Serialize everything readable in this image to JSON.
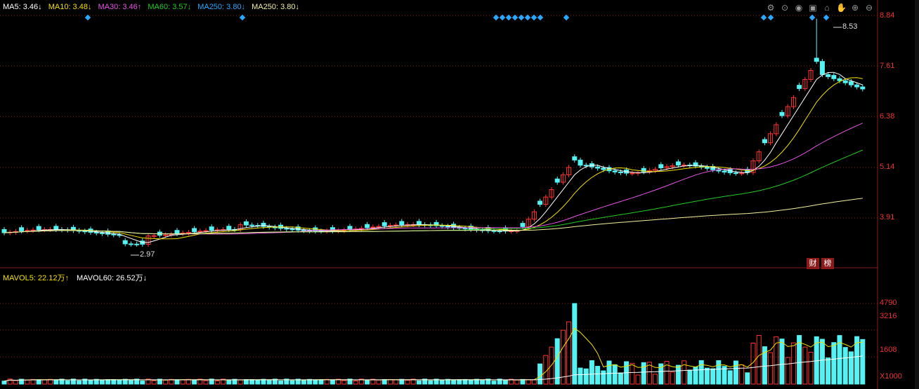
{
  "ma_legend": [
    {
      "label": "MA5: 3.46↓",
      "color": "#ffffff"
    },
    {
      "label": "MA10: 3.48↓",
      "color": "#f2e000"
    },
    {
      "label": "MA30: 3.46↑",
      "color": "#e655e6"
    },
    {
      "label": "MA60: 3.57↓",
      "color": "#22cc22"
    },
    {
      "label": "MA250: 3.80↓",
      "color": "#2aa8ff"
    },
    {
      "label": "MA250: 3.80↓",
      "color": "#f2f2a0"
    }
  ],
  "vol_legend": [
    {
      "label": "MAVOL5: 22.12万↑",
      "color": "#f2e000"
    },
    {
      "label": "MAVOL60: 26.52万↓",
      "color": "#ffffff"
    }
  ],
  "price_axis": [
    "8.84",
    "7.61",
    "6.38",
    "5.14",
    "3.91"
  ],
  "vol_axis": [
    "4790",
    "3216",
    "1608",
    "X1000"
  ],
  "high_label": "8.53",
  "low_label": "2.97",
  "badges": [
    "财",
    "榜"
  ],
  "toolbar_icons": [
    "settings-icon",
    "zoom-icon",
    "eye-icon",
    "lock-icon",
    "home-icon",
    "hand-icon",
    "zoom-in-icon",
    "zoom-out-icon"
  ],
  "colors": {
    "up": "#ff3333",
    "down": "#54f2f2",
    "axis": "#e33",
    "grid": "#8b1a1a"
  },
  "chart_data": [
    {
      "type": "candlestick",
      "title": "",
      "ylim": [
        2.9,
        8.9
      ],
      "ticks": [
        8.84,
        7.61,
        6.38,
        5.14,
        3.91
      ],
      "high": 8.53,
      "low": 2.97
    },
    {
      "type": "bar",
      "title": "",
      "ylim": [
        0,
        4790
      ],
      "ticks": [
        4790,
        3216,
        1608
      ],
      "unit": "X1000"
    }
  ]
}
